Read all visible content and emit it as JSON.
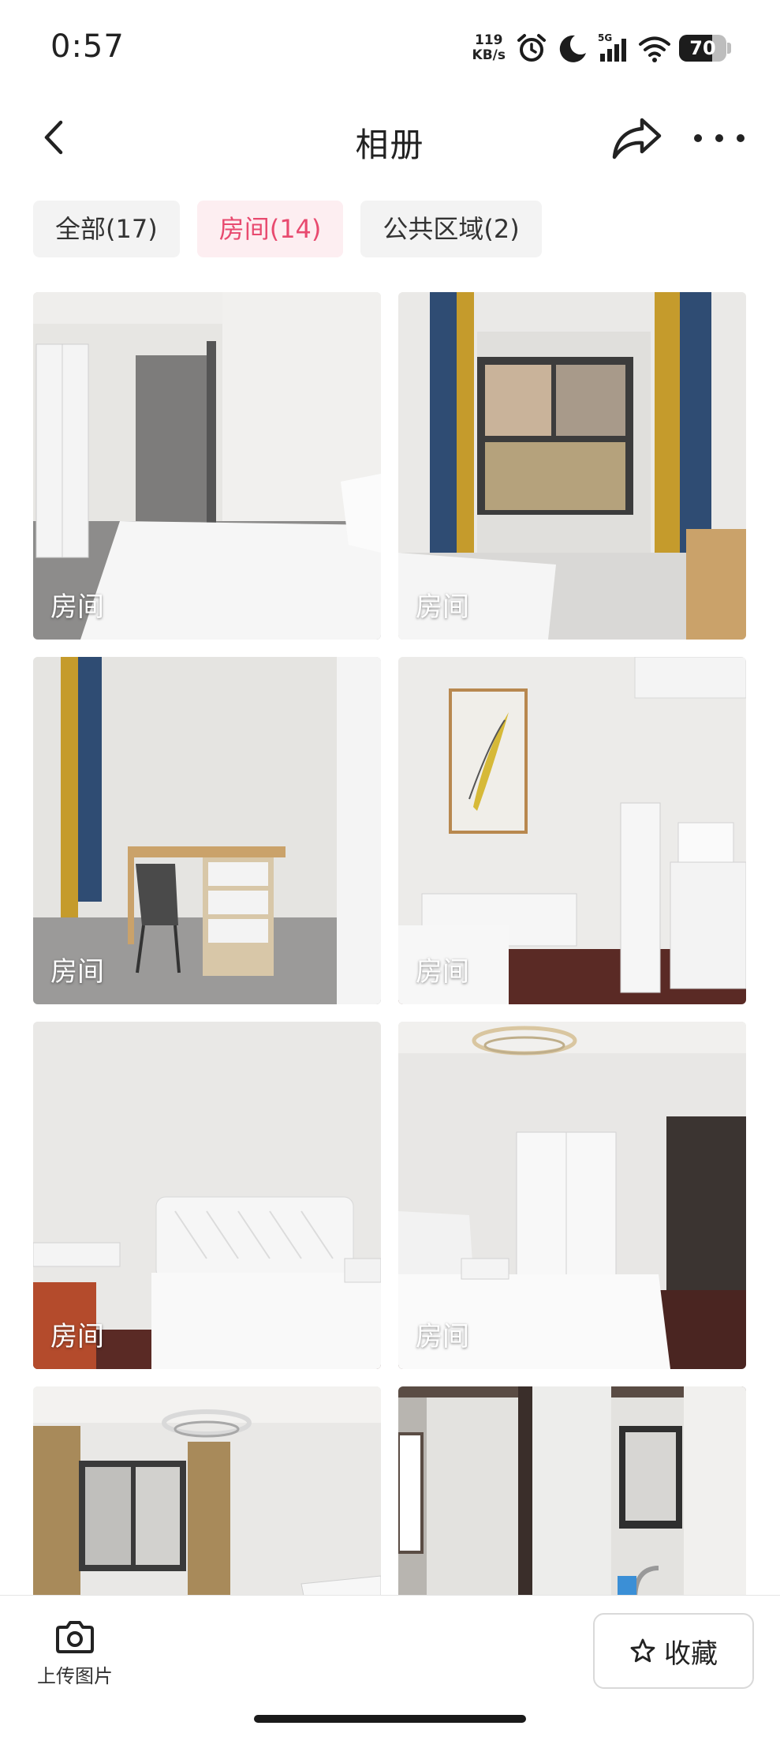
{
  "status_bar": {
    "time": "0:57",
    "net_speed_value": "119",
    "net_speed_unit": "KB/s",
    "network_type": "5G",
    "battery_level": "70",
    "battery_fraction": 0.7
  },
  "nav": {
    "title": "相册",
    "icons": [
      "chevron-left-icon",
      "share-icon",
      "more-icon"
    ]
  },
  "tabs": [
    {
      "label": "全部(17)",
      "active": false
    },
    {
      "label": "房间(14)",
      "active": true
    },
    {
      "label": "公共区域(2)",
      "active": false
    }
  ],
  "photos": [
    {
      "label": "房间"
    },
    {
      "label": "房间"
    },
    {
      "label": "房间"
    },
    {
      "label": "房间"
    },
    {
      "label": "房间"
    },
    {
      "label": "房间"
    },
    {
      "label": ""
    },
    {
      "label": ""
    }
  ],
  "bottom_bar": {
    "upload_label": "上传图片",
    "favorite_label": "收藏"
  },
  "colors": {
    "accent": "#e84a6f",
    "accent_bg": "#fdeef1",
    "tab_bg": "#f3f3f3"
  }
}
